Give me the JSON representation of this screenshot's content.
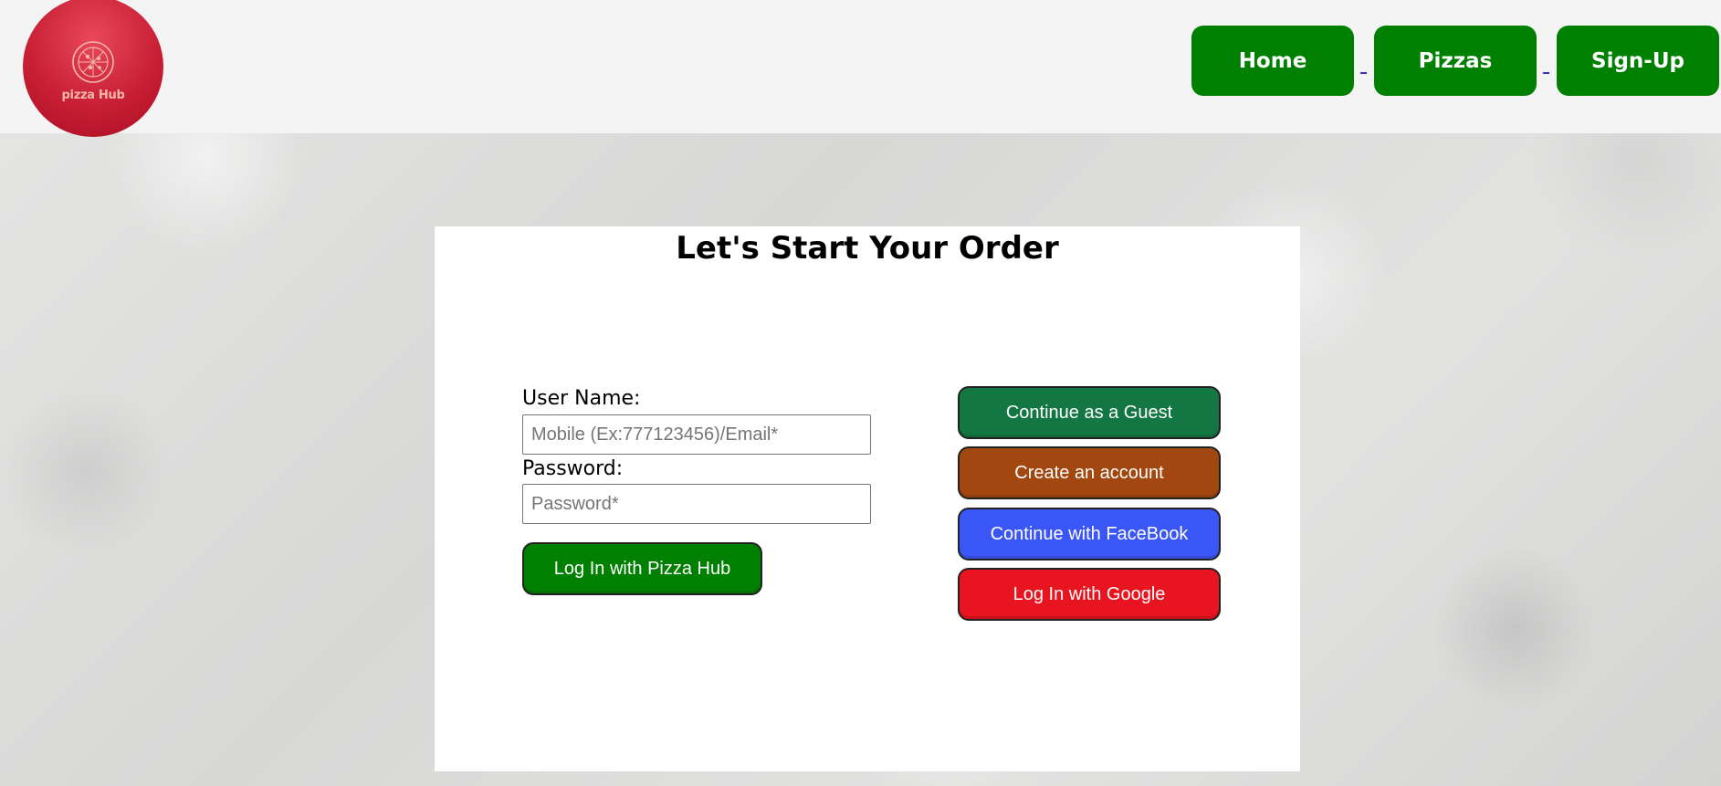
{
  "header": {
    "logo_text": "pizza Hub",
    "nav": [
      {
        "label": "Home"
      },
      {
        "label": "Pizzas"
      },
      {
        "label": "Sign-Up"
      }
    ]
  },
  "login": {
    "title": "Let's Start Your Order",
    "username_label": "User Name:",
    "username_placeholder": "Mobile (Ex:777123456)/Email*",
    "username_value": "",
    "password_label": "Password:",
    "password_placeholder": "Password*",
    "password_value": "",
    "login_button": "Log In with Pizza Hub"
  },
  "options": {
    "guest": "Continue as a Guest",
    "create": "Create an account",
    "facebook": "Continue with FaceBook",
    "google": "Log In with Google"
  },
  "colors": {
    "nav_green": "#008000",
    "login_green": "#008000",
    "guest_green": "#137744",
    "create_brown": "#a34710",
    "facebook_blue": "#3b56f6",
    "google_red": "#e8141f",
    "logo_red": "#c91f35"
  }
}
